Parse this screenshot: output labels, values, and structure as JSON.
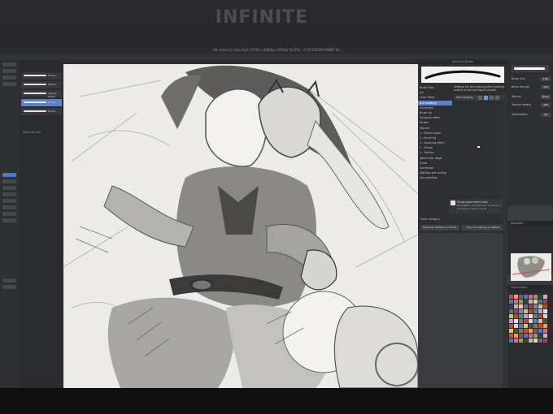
{
  "wall_sign": "INFINITE",
  "window": {
    "title": "the moon 2 color.clip* (7235 x 4800px 300dpi 50.0%) - CLIP STUDIO PAINT EX"
  },
  "menu": [
    "File",
    "Edit",
    "Animation",
    "Layer",
    "Select",
    "View",
    "Filter",
    "Window",
    "Help"
  ],
  "doc_tabs": [
    "the moon 2 color.clip*",
    "the moon 2..."
  ],
  "subtool": {
    "tabs": [
      "Edit",
      "Pencil",
      "Brush"
    ],
    "items": [
      {
        "name": "Stroke"
      },
      {
        "name": "Stroke"
      },
      {
        "name": "Lighter Pastel"
      },
      {
        "name": "Stroke"
      },
      {
        "name": "Stroke"
      }
    ],
    "add_label": "Add sub tool"
  },
  "detail": {
    "title": "Sub Tool Detail",
    "categories": [
      "Brush Size",
      "Ink",
      "Color Mixer",
      "Anti-aliasing",
      "Correction",
      "Brush tip",
      "Spraying effect",
      "Stroke",
      "Texture",
      "2 - Brush shape",
      "2 - Brush tip",
      "2 - Spraying effect",
      "2 - Stroke",
      "2 - Texture",
      "Watercolor edge",
      "Erase",
      "Correction",
      "Starting and ending",
      "Anti-overflow"
    ],
    "selected_category": 3,
    "description": "Settings for anti-aliasing effect making outline of line and figure smooth",
    "aa_label": "Anti-aliasing",
    "help_title": "Show parameter help",
    "help_body": "Description of each item is shown if you hover cursor over it",
    "show_category": "Show category",
    "reset_label": "Reset all settings to default",
    "save_label": "Save all settings as default"
  },
  "right_props": [
    {
      "label": "Brush Size",
      "value": "18.0"
    },
    {
      "label": "Brush density",
      "value": "100"
    },
    {
      "label": "Texture",
      "value": "None"
    },
    {
      "label": "Texture density",
      "value": "100"
    },
    {
      "label": "Stabilization",
      "value": "10"
    }
  ],
  "navigator_title": "Navigator",
  "color_title": "Color history",
  "colors": {
    "accent": "#5b82c7",
    "canvas": "#eeede9",
    "palette": [
      "#c94b3f",
      "#e0a45c",
      "#7c4f8c",
      "#4b79b0",
      "#d96b7c",
      "#8aa35b",
      "#3f3f3f",
      "#b8b8b8",
      "#e6d0b5",
      "#5c6d8a",
      "#a83c4c",
      "#6c8ec0",
      "#d8c06a",
      "#8c5a3c",
      "#4d8a7c",
      "#c0a0d0",
      "#f0e0e0",
      "#7a7a7a",
      "#b04848",
      "#d8d8d8",
      "#5a7fb8",
      "#e0c090",
      "#3c5c3c",
      "#a07050"
    ]
  }
}
